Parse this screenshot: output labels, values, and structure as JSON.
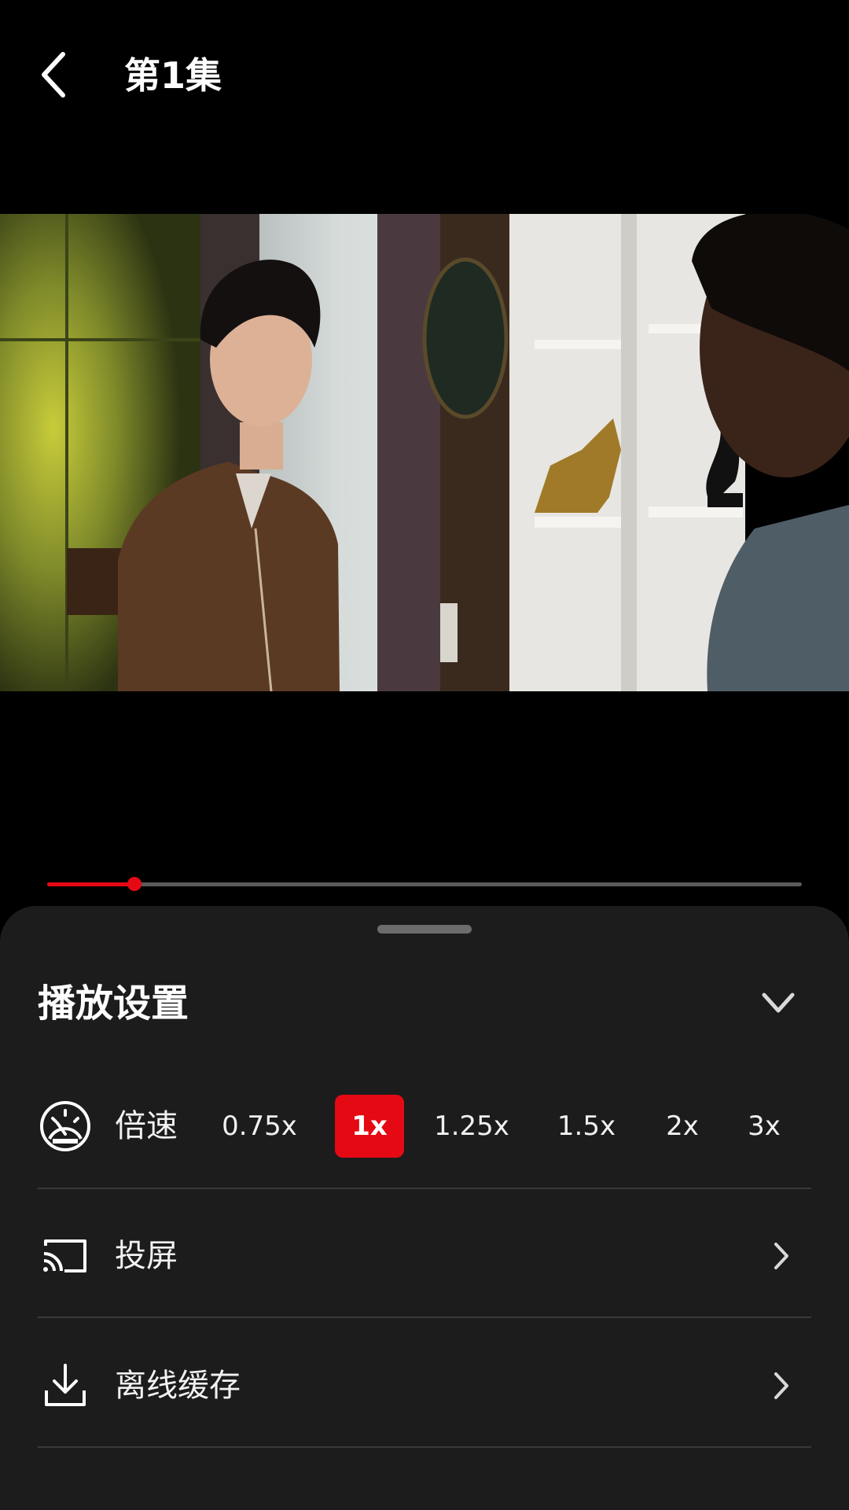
{
  "header": {
    "title": "第1集",
    "back_icon": "chevron-left-icon"
  },
  "progress": {
    "fraction": 0.116,
    "color": "#e50914"
  },
  "sheet": {
    "title": "播放设置",
    "collapse_icon": "chevron-down-icon",
    "speed": {
      "label": "倍速",
      "icon": "speedometer-icon",
      "options": [
        "0.75x",
        "1x",
        "1.25x",
        "1.5x",
        "2x",
        "3x"
      ],
      "selected": "1x"
    },
    "cast": {
      "label": "投屏",
      "icon": "cast-icon"
    },
    "offline": {
      "label": "离线缓存",
      "icon": "download-icon"
    }
  },
  "colors": {
    "accent": "#e50914",
    "sheet_bg": "#1c1c1c",
    "divider": "#3a3a3a"
  }
}
